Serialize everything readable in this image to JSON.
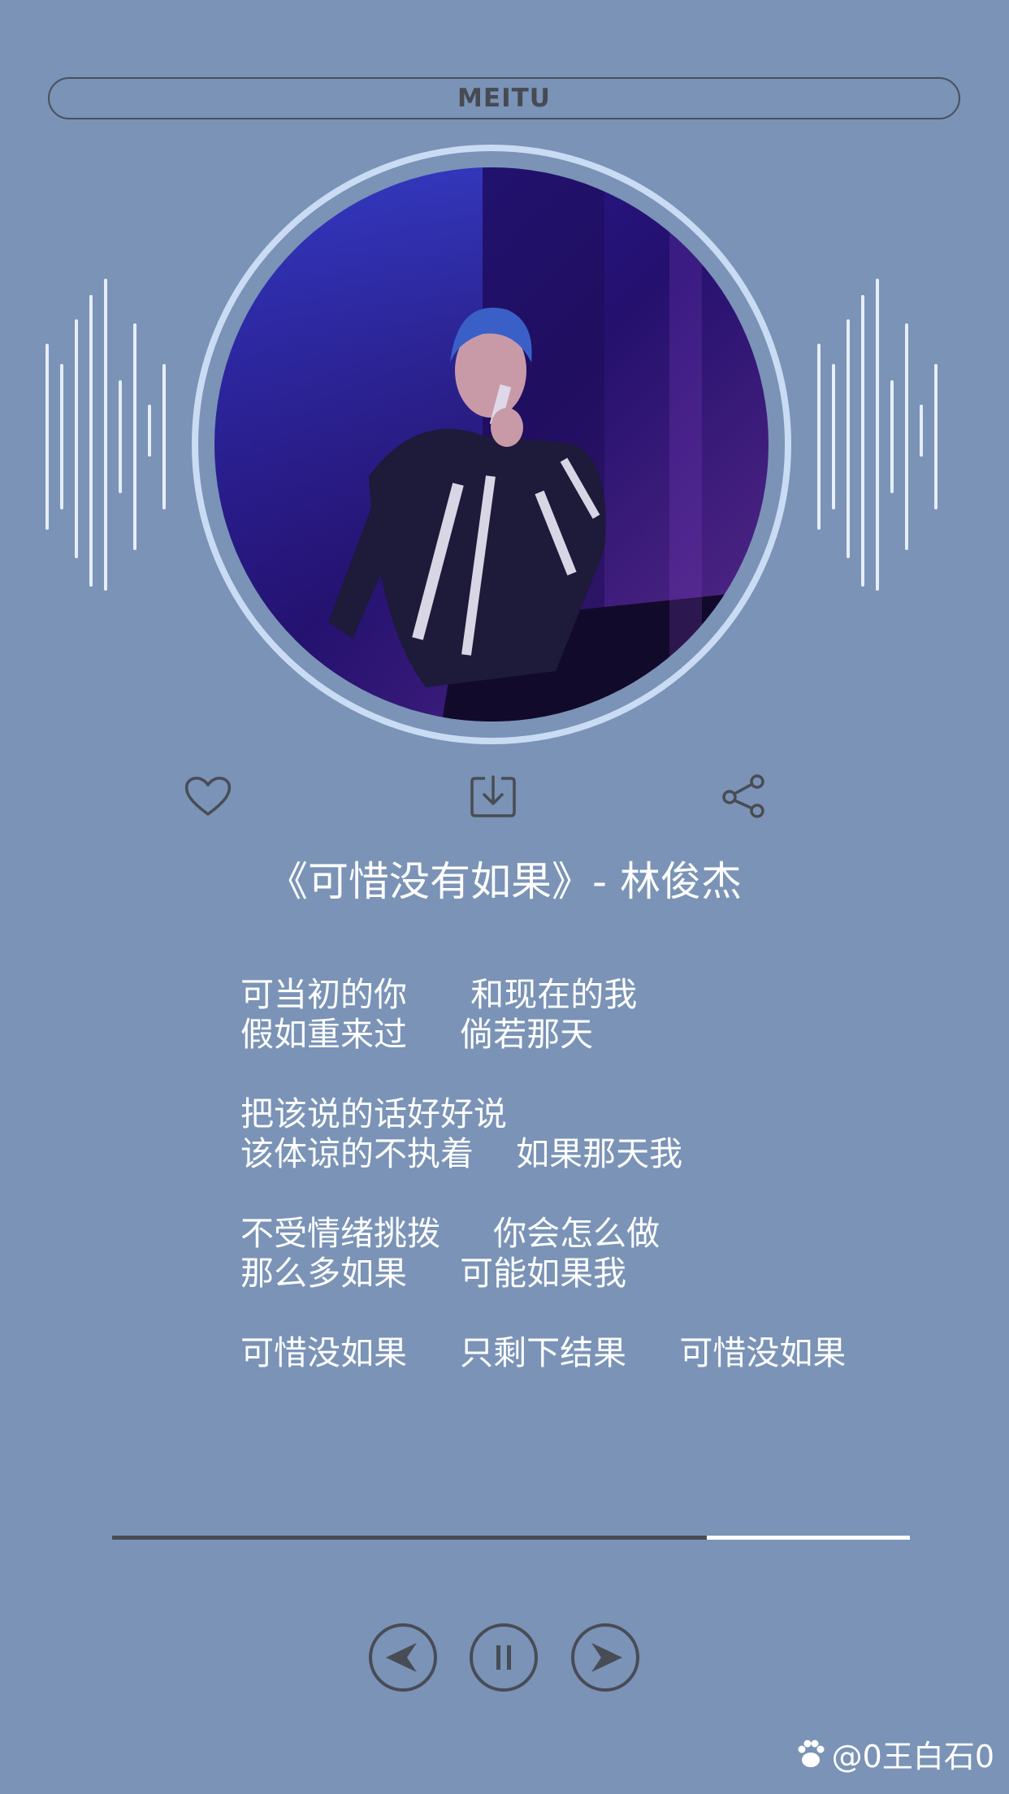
{
  "app": {
    "header_label": "MEITU"
  },
  "song": {
    "title": "《可惜没有如果》- 林俊杰"
  },
  "actions": [
    {
      "icon": "heart-icon"
    },
    {
      "icon": "download-icon"
    },
    {
      "icon": "share-icon"
    }
  ],
  "lyrics": [
    [
      "可当初的你      和现在的我",
      "假如重来过     倘若那天"
    ],
    [
      "把该说的话好好说",
      "该体谅的不执着    如果那天我"
    ],
    [
      "不受情绪挑拨     你会怎么做",
      "那么多如果     可能如果我"
    ],
    [
      "可惜没如果     只剩下结果     可惜没如果"
    ]
  ],
  "playback": {
    "progress_fraction": 0.745
  },
  "controls": [
    {
      "icon": "previous-icon"
    },
    {
      "icon": "pause-icon"
    },
    {
      "icon": "next-icon"
    }
  ],
  "watermark": {
    "text": "@0王白石0"
  },
  "colors": {
    "background": "#7a93b6",
    "ring": "#c9dcf3",
    "dark": "#484c55",
    "text": "#ffffff"
  }
}
